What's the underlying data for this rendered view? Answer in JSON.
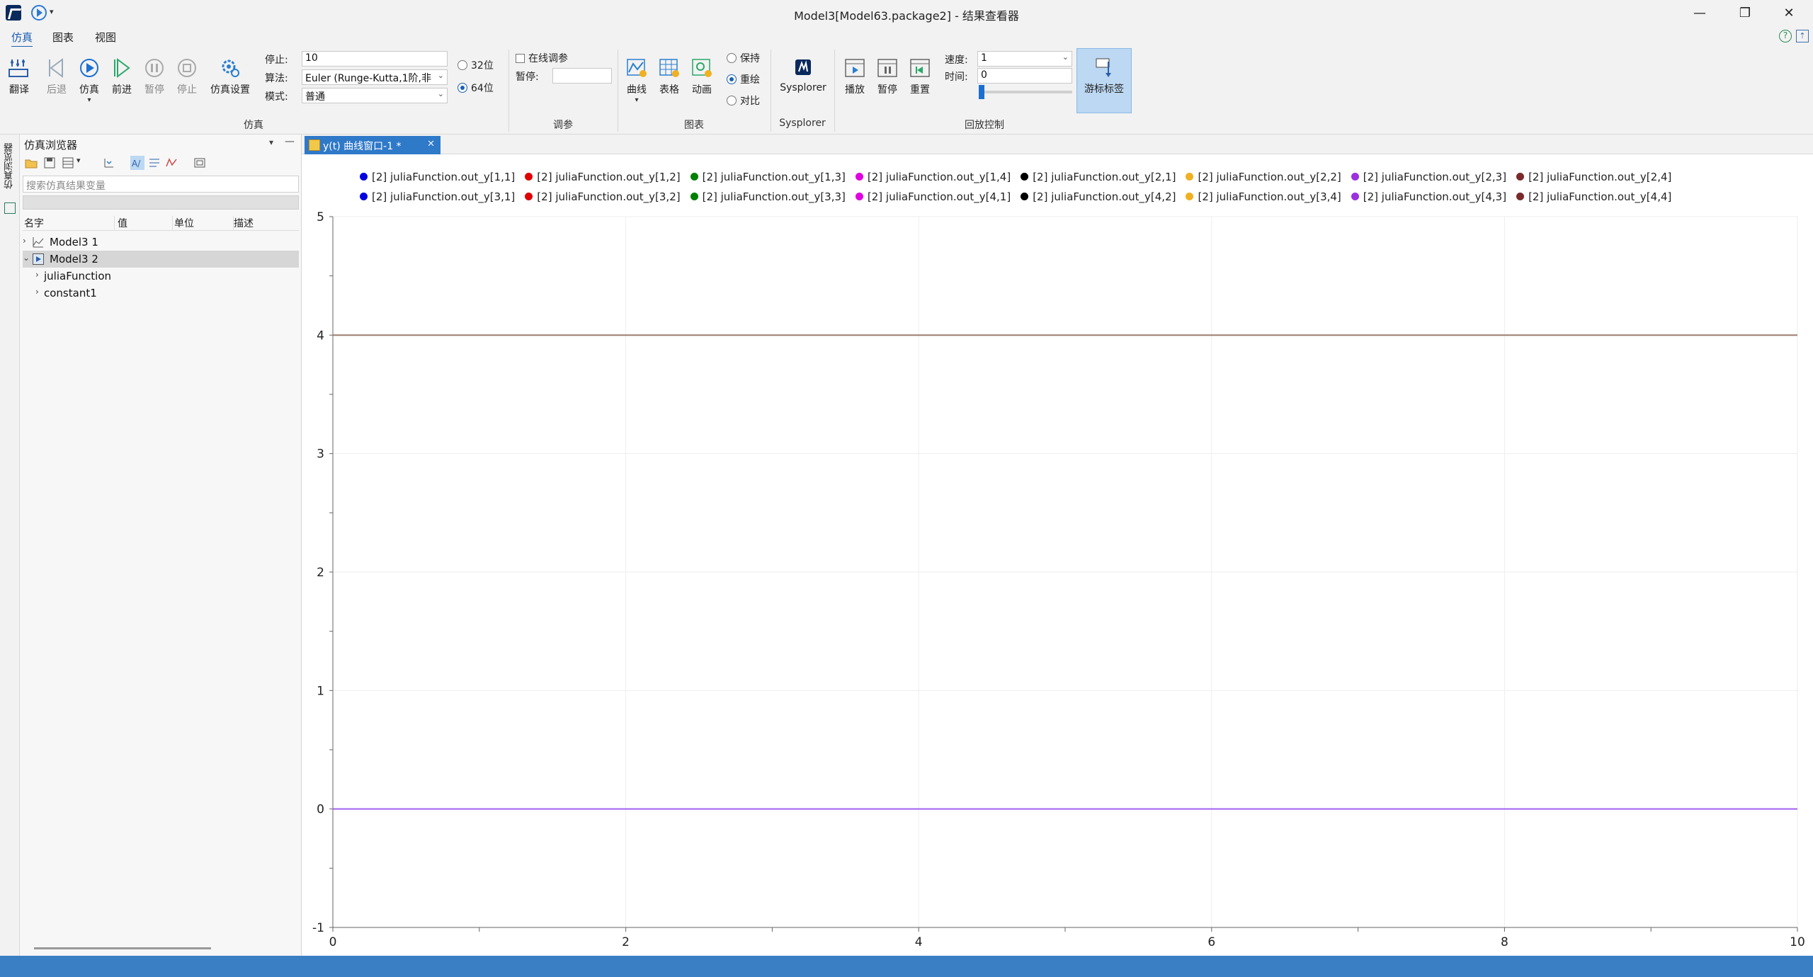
{
  "window": {
    "title": "Model3[Model63.package2] - 结果查看器",
    "minimize": "—",
    "maximize": "❐",
    "close": "✕"
  },
  "menu": {
    "tabs": [
      "仿真",
      "图表",
      "视图"
    ],
    "active_tab": "仿真"
  },
  "ribbon": {
    "sim_group": {
      "label": "仿真",
      "buttons": [
        "翻译",
        "后退",
        "仿真",
        "前进",
        "暂停",
        "停止",
        "仿真设置"
      ],
      "stop_label": "停止:",
      "stop_value": "10",
      "algo_label": "算法:",
      "algo_value": "Euler (Runge-Kutta,1阶,非",
      "mode_label": "模式:",
      "mode_value": "普通",
      "bits_32": "32位",
      "bits_64": "64位",
      "bits_selected": "64位"
    },
    "tune_group": {
      "label": "调参",
      "online_tune": "在线调参",
      "pause_label": "暂停:",
      "pause_value": ""
    },
    "chart_group": {
      "label": "图表",
      "buttons": [
        "曲线",
        "表格",
        "动画"
      ],
      "radio_keep": "保持",
      "radio_redraw": "重绘",
      "radio_compare": "对比",
      "radio_selected": "重绘"
    },
    "sysplorer_group": {
      "label": "Sysplorer",
      "button": "Sysplorer"
    },
    "replay_group": {
      "label": "回放控制",
      "buttons": [
        "播放",
        "暂停",
        "重置"
      ],
      "speed_label": "速度:",
      "speed_value": "1",
      "time_label": "时间:",
      "time_value": "0",
      "cursor_label": "游标标签"
    }
  },
  "side_strip": {
    "label": "仿真浏览器"
  },
  "browser": {
    "title": "仿真浏览器",
    "search_placeholder": "搜索仿真结果变量",
    "columns": [
      "名字",
      "值",
      "单位",
      "描述"
    ],
    "rows": [
      "Model3 1",
      "Model3 2",
      "juliaFunction",
      "constant1"
    ],
    "min_btn": "—",
    "drop_btn": "▾"
  },
  "plot_tab": {
    "label": "y(t) 曲线窗口-1 *",
    "close": "✕"
  },
  "legend": [
    {
      "label": "[2] juliaFunction.out_y[1,1]",
      "color": "#0000e0"
    },
    {
      "label": "[2] juliaFunction.out_y[1,2]",
      "color": "#e00000"
    },
    {
      "label": "[2] juliaFunction.out_y[1,3]",
      "color": "#008000"
    },
    {
      "label": "[2] juliaFunction.out_y[1,4]",
      "color": "#e000e0"
    },
    {
      "label": "[2] juliaFunction.out_y[2,1]",
      "color": "#000000"
    },
    {
      "label": "[2] juliaFunction.out_y[2,2]",
      "color": "#f0b020"
    },
    {
      "label": "[2] juliaFunction.out_y[2,3]",
      "color": "#9a30e0"
    },
    {
      "label": "[2] juliaFunction.out_y[2,4]",
      "color": "#7a2a2a"
    },
    {
      "label": "[2] juliaFunction.out_y[3,1]",
      "color": "#0000e0"
    },
    {
      "label": "[2] juliaFunction.out_y[3,2]",
      "color": "#e00000"
    },
    {
      "label": "[2] juliaFunction.out_y[3,3]",
      "color": "#008000"
    },
    {
      "label": "[2] juliaFunction.out_y[4,1]",
      "color": "#e000e0"
    },
    {
      "label": "[2] juliaFunction.out_y[4,2]",
      "color": "#000000"
    },
    {
      "label": "[2] juliaFunction.out_y[3,4]",
      "color": "#f0b020"
    },
    {
      "label": "[2] juliaFunction.out_y[4,3]",
      "color": "#9a30e0"
    },
    {
      "label": "[2] juliaFunction.out_y[4,4]",
      "color": "#7a2a2a"
    }
  ],
  "chart_data": {
    "type": "line",
    "xlim": [
      0,
      10
    ],
    "ylim": [
      -1,
      5
    ],
    "x_ticks": [
      "0",
      "2",
      "4",
      "6",
      "8",
      "10"
    ],
    "y_ticks": [
      "-1",
      "0",
      "1",
      "2",
      "3",
      "4",
      "5"
    ],
    "grid": true,
    "series": [
      {
        "name": "[2] juliaFunction.out_y[4,4]",
        "color": "#9c7a6a",
        "x": [
          0,
          10
        ],
        "y": [
          4,
          4
        ]
      },
      {
        "name": "[2] juliaFunction.out_y[4,3]",
        "color": "#a060f0",
        "x": [
          0,
          10
        ],
        "y": [
          0,
          0
        ]
      }
    ]
  }
}
